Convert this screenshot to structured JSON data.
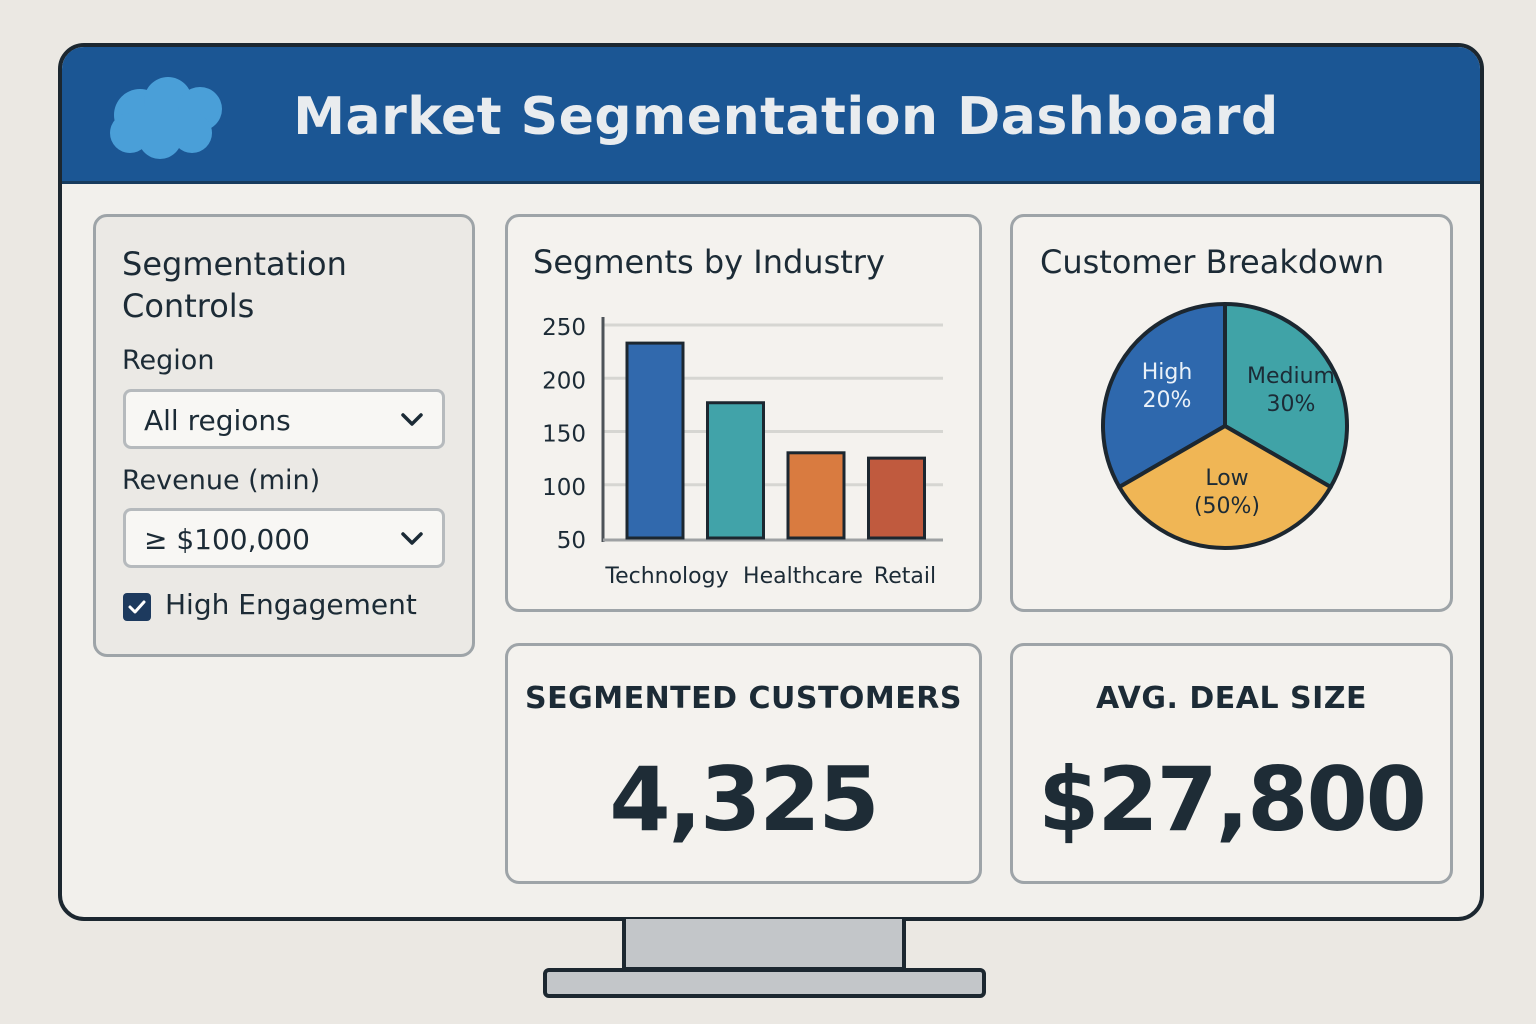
{
  "header": {
    "title": "Market Segmentation Dashboard",
    "logo_icon": "cloud-logo-icon",
    "bg_color": "#1b5694"
  },
  "controls": {
    "title": "Segmentation Controls",
    "region_label": "Region",
    "region_value": "All regions",
    "revenue_label": "Revenue (min)",
    "revenue_value": "≥ $100,000",
    "high_engagement_label": "High Engagement",
    "high_engagement_checked": true
  },
  "segments_chart": {
    "title": "Segments by Industry"
  },
  "breakdown_chart": {
    "title": "Customer Breakdown"
  },
  "chart_data": [
    {
      "type": "bar",
      "title": "Segments by Industry",
      "categories": [
        "Technology",
        "",
        "Healthcare",
        "Retail"
      ],
      "values": [
        233,
        177,
        130,
        125
      ],
      "colors": [
        "#3169ad",
        "#41a3a9",
        "#d97b40",
        "#c05a3e"
      ],
      "ylim": [
        50,
        250
      ],
      "yticks": [
        250,
        200,
        150,
        100,
        50
      ],
      "grid": true
    },
    {
      "type": "pie",
      "title": "Customer Breakdown",
      "slices": [
        {
          "label": "High",
          "pct_label": "20%",
          "value": 33.3,
          "color": "#2e68ad"
        },
        {
          "label": "Medium",
          "pct_label": "30%",
          "value": 33.3,
          "color": "#40a3a7"
        },
        {
          "label": "Low",
          "pct_label": "(50%)",
          "value": 33.4,
          "color": "#f0b655"
        }
      ]
    }
  ],
  "kpis": {
    "customers_label": "SEGMENTED CUSTOMERS",
    "customers_value": "4,325",
    "deal_label": "AVG. DEAL SIZE",
    "deal_value": "$27,800"
  }
}
